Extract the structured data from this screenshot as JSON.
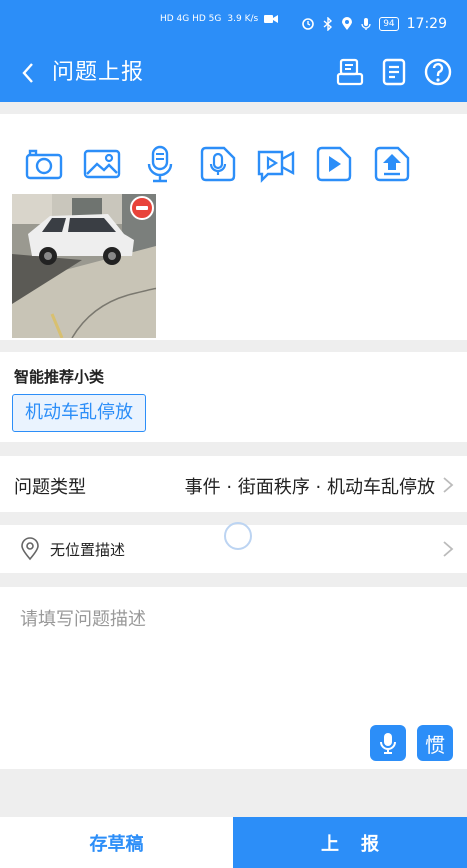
{
  "status_bar": {
    "network": "HD 4G HD 5G",
    "speed": "3.9 K/s",
    "battery": "94",
    "time": "17:29"
  },
  "header": {
    "title": "问题上报",
    "icons": [
      "back-arrow-icon",
      "drafts-icon",
      "list-icon",
      "help-icon"
    ]
  },
  "media_tools": [
    "camera-icon",
    "image-icon",
    "microphone-icon",
    "audio-file-icon",
    "video-camera-icon",
    "play-video-icon",
    "upload-icon"
  ],
  "recommend": {
    "label": "智能推荐小类",
    "tag": "机动车乱停放"
  },
  "problem_type": {
    "label": "问题类型",
    "value": "事件 · 街面秩序 · 机动车乱停放"
  },
  "location": {
    "label": "无位置描述"
  },
  "description": {
    "placeholder": "请填写问题描述",
    "habit_button": "惯"
  },
  "footer": {
    "draft": "存草稿",
    "submit": "上报"
  },
  "colors": {
    "primary": "#2c8ef8",
    "danger": "#e8433a"
  }
}
